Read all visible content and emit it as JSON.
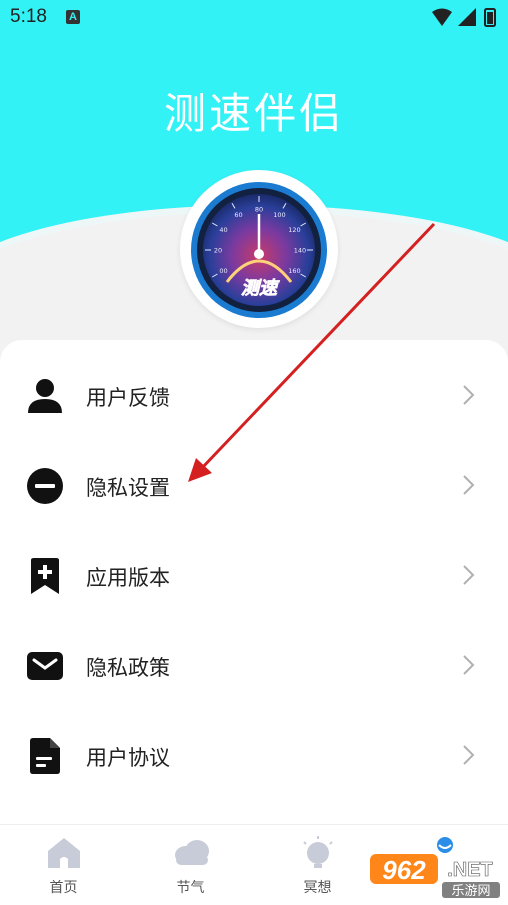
{
  "status_bar": {
    "time": "5:18",
    "notif_letter": "A"
  },
  "header": {
    "title": "测速伴侣"
  },
  "logo": {
    "label": "测速",
    "gauge_ticks": [
      "00",
      "20",
      "40",
      "60",
      "80",
      "100",
      "120",
      "140",
      "160"
    ]
  },
  "menu": [
    {
      "label": "用户反馈",
      "icon": "person-icon"
    },
    {
      "label": "隐私设置",
      "icon": "minus-circle-icon"
    },
    {
      "label": "应用版本",
      "icon": "bookmark-plus-icon"
    },
    {
      "label": "隐私政策",
      "icon": "envelope-icon"
    },
    {
      "label": "用户协议",
      "icon": "document-icon"
    }
  ],
  "tabs": [
    {
      "label": "首页",
      "icon": "home-icon"
    },
    {
      "label": "节气",
      "icon": "cloud-icon"
    },
    {
      "label": "冥想",
      "icon": "bulb-icon"
    },
    {
      "label": "",
      "icon": "profile-icon"
    }
  ],
  "watermark": {
    "text": "962",
    "suffix": ".NET",
    "sub": "乐游网"
  },
  "colors": {
    "header_bg": "#33f2f5",
    "arrow": "#d42020",
    "icon_gray": "#c8ccd8"
  }
}
